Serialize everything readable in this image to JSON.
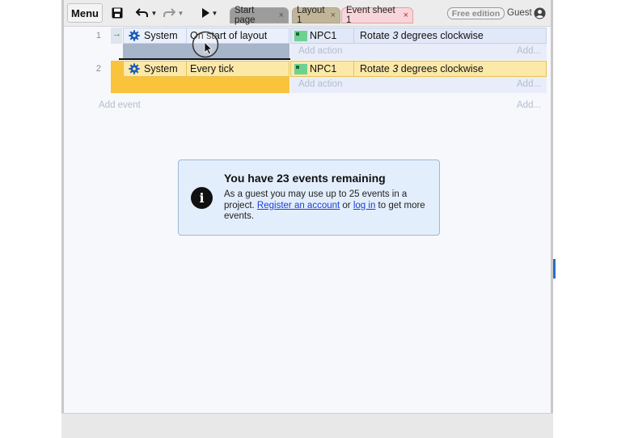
{
  "toolbar": {
    "menu_label": "Menu",
    "tabs": [
      {
        "label": "Start page"
      },
      {
        "label": "Layout 1"
      },
      {
        "label": "Event sheet 1"
      }
    ],
    "close_glyph": "×",
    "edition_badge": "Free edition",
    "user_label": "Guest"
  },
  "events": [
    {
      "number": "1",
      "object": "System",
      "condition": "On start of layout",
      "action_object": "NPC1",
      "action_prefix": "Rotate ",
      "action_value": "3",
      "action_suffix": " degrees clockwise",
      "add_action": "Add action",
      "add_short": "Add..."
    },
    {
      "number": "2",
      "object": "System",
      "condition": "Every tick",
      "action_object": "NPC1",
      "action_prefix": "Rotate ",
      "action_value": "3",
      "action_suffix": " degrees clockwise",
      "add_action": "Add action",
      "add_short": "Add..."
    }
  ],
  "sheet": {
    "add_event": "Add event",
    "add_short": "Add..."
  },
  "notice": {
    "title": "You have 23 events remaining",
    "text_1": "As a guest you may use up to 25 events in a project. ",
    "link_register": "Register an account",
    "text_2": " or ",
    "link_login": "log in",
    "text_3": " to get more events."
  },
  "colors": {
    "accent": "#2b6cc4",
    "selected_event": "#fce9a8",
    "selected_event_strip": "#f9c33c",
    "condition_row": "#e9eefb",
    "action_row": "#dfe6f8",
    "object_icon": "#6ed191"
  },
  "icons": [
    "save-icon",
    "undo-icon",
    "redo-icon",
    "play-icon",
    "gear-icon",
    "info-icon",
    "user-icon",
    "arrow-right-icon",
    "cursor-icon"
  ]
}
